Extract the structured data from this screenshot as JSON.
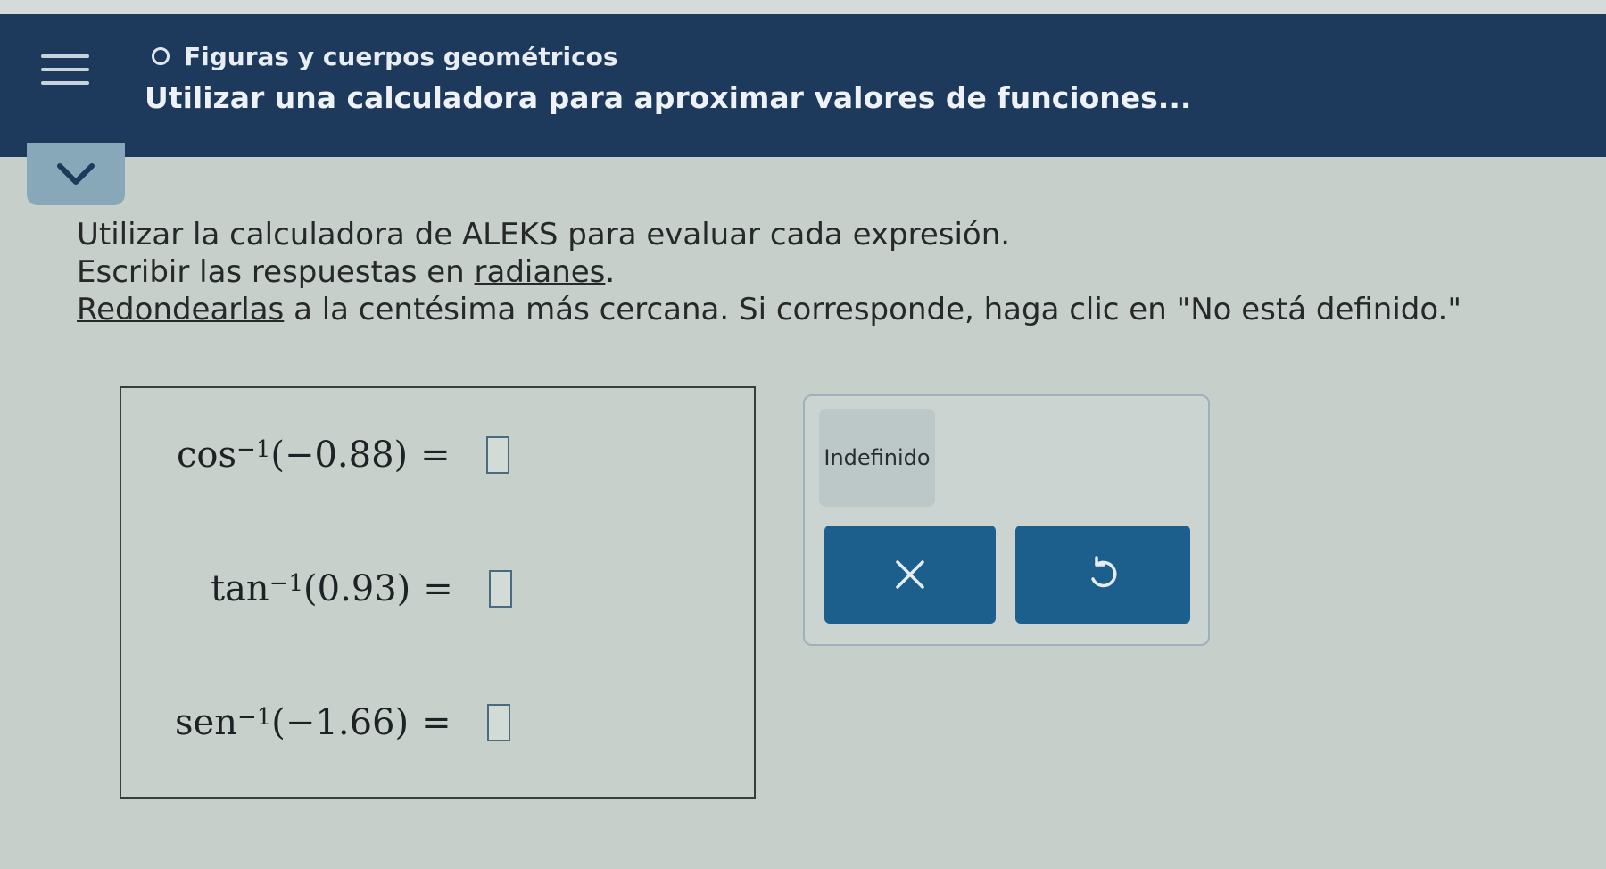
{
  "header": {
    "topic": "Figuras y cuerpos geométricos",
    "lesson_title": "Utilizar una calculadora para aproximar valores de funciones..."
  },
  "instructions": {
    "line1": "Utilizar la calculadora de ALEKS para evaluar cada expresión.",
    "line2_prefix": "Escribir las respuestas en ",
    "line2_link": "radianes",
    "line2_suffix": ".",
    "line3_link": "Redondearlas",
    "line3_suffix": " a la centésima más cercana. Si corresponde, haga clic en \"No está definido.\""
  },
  "expressions": [
    {
      "func": "cos",
      "exp": "−1",
      "arg": "(−0.88)",
      "eq": "=",
      "answer": ""
    },
    {
      "func": "tan",
      "exp": "−1",
      "arg": "(0.93)",
      "eq": "=",
      "answer": ""
    },
    {
      "func": "sen",
      "exp": "−1",
      "arg": "(−1.66)",
      "eq": "=",
      "answer": ""
    }
  ],
  "panel": {
    "undefined_label": "Indefinido",
    "clear_icon": "close-icon",
    "undo_icon": "undo-icon"
  },
  "colors": {
    "header_bg": "#1d3a5c",
    "button_bg": "#1d5f8c",
    "page_bg": "#c6cfc9"
  }
}
